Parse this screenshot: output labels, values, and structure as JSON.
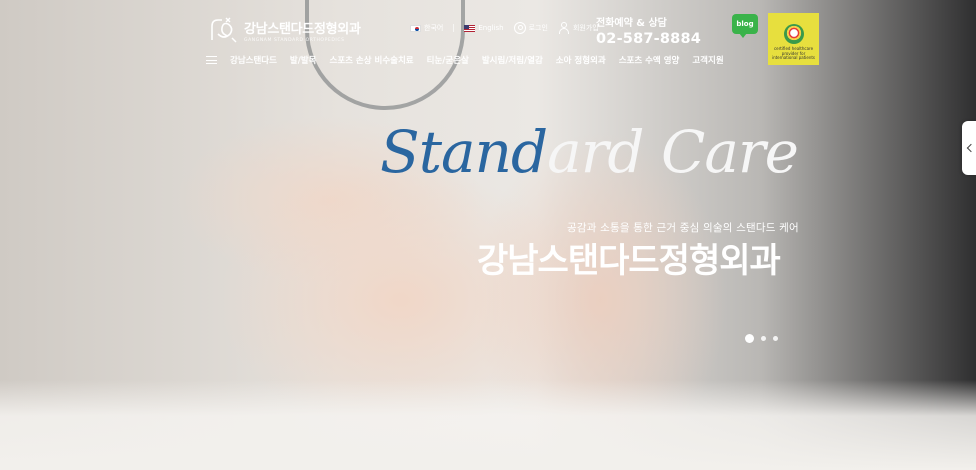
{
  "brand": {
    "name": "강남스탠다드정형외과",
    "subtitle": "GANGNAM STANDARD ORTHOPEDICS"
  },
  "util": {
    "korean": "한국어",
    "english": "English",
    "login": "로그인",
    "join": "회원가입"
  },
  "contact": {
    "label": "전화예약 & 상담",
    "phone": "02-587-8884"
  },
  "blog": {
    "label": "blog"
  },
  "cert": {
    "text": "certified healthcare provider for international patients"
  },
  "nav": {
    "items": [
      "강남스탠다드",
      "발/발목",
      "스포츠 손상 비수술치료",
      "티눈/굳은살",
      "발시림/저림/열감",
      "소아 정형외과",
      "스포츠 수액 영양",
      "고객지원"
    ]
  },
  "hero": {
    "script_dark": "Stand",
    "script_light": "ard Care",
    "tagline": "공감과 소통을 통한 근거 중심 의술의 스탠다드 케어",
    "headline": "강남스탠다드정형외과"
  },
  "slider": {
    "total": 3,
    "active_index": 0
  },
  "colors": {
    "accent_blue": "#2a66a0",
    "blog_green": "#3ab34a",
    "cert_yellow": "#e7df3e"
  },
  "icons": [
    "logo-icon",
    "flag-kr-icon",
    "flag-us-icon",
    "user-icon",
    "join-icon",
    "hamburger-icon",
    "chevron-left-icon"
  ]
}
